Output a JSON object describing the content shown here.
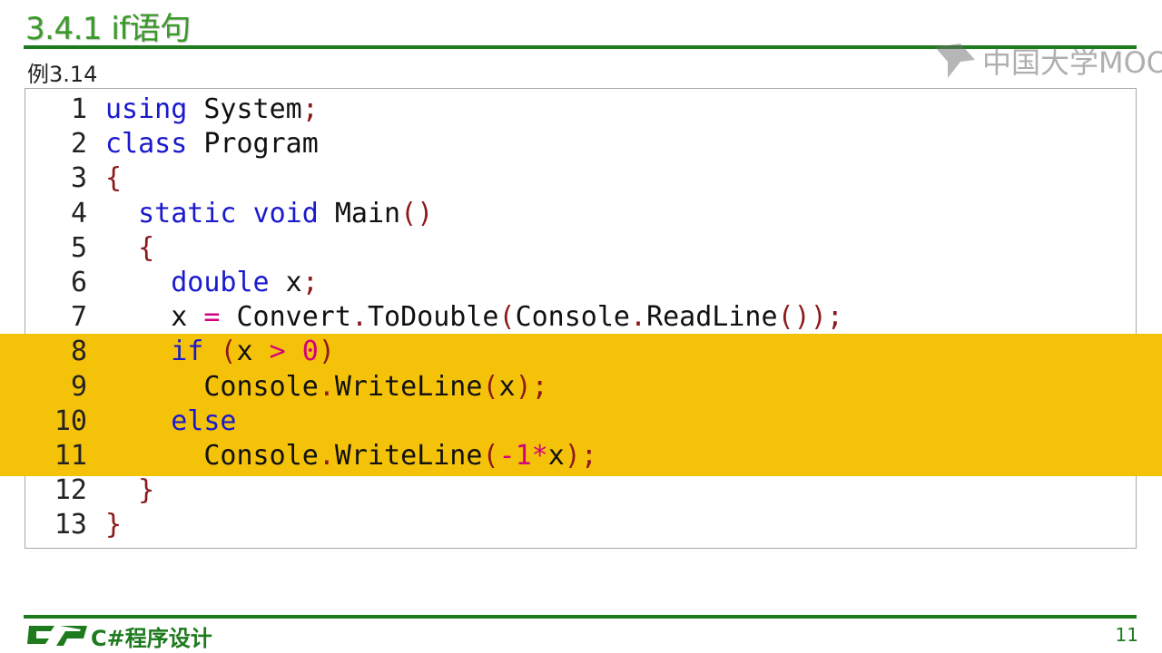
{
  "slide": {
    "title": "3.4.1  if语句",
    "example_label": "例3.14",
    "watermark": "中国大学MOOC",
    "footer_course": "C#程序设计",
    "page_number": "11",
    "highlight_lines": [
      8,
      9,
      10,
      11
    ],
    "colors": {
      "title": "#3a9a2a",
      "rule": "#1d7a1d",
      "highlight": "#f5c20a",
      "keyword": "#1a1acc",
      "punctuation": "#8b1a1a",
      "operator": "#d4007f"
    }
  },
  "code": {
    "lines": [
      {
        "n": "1",
        "text": "using System;"
      },
      {
        "n": "2",
        "text": "class Program"
      },
      {
        "n": "3",
        "text": "{"
      },
      {
        "n": "4",
        "text": "  static void Main()"
      },
      {
        "n": "5",
        "text": "  {"
      },
      {
        "n": "6",
        "text": "    double x;"
      },
      {
        "n": "7",
        "text": "    x = Convert.ToDouble(Console.ReadLine());"
      },
      {
        "n": "8",
        "text": "    if (x > 0)"
      },
      {
        "n": "9",
        "text": "      Console.WriteLine(x);"
      },
      {
        "n": "10",
        "text": "    else"
      },
      {
        "n": "11",
        "text": "      Console.WriteLine(-1*x);"
      },
      {
        "n": "12",
        "text": "  }"
      },
      {
        "n": "13",
        "text": "}"
      }
    ]
  }
}
